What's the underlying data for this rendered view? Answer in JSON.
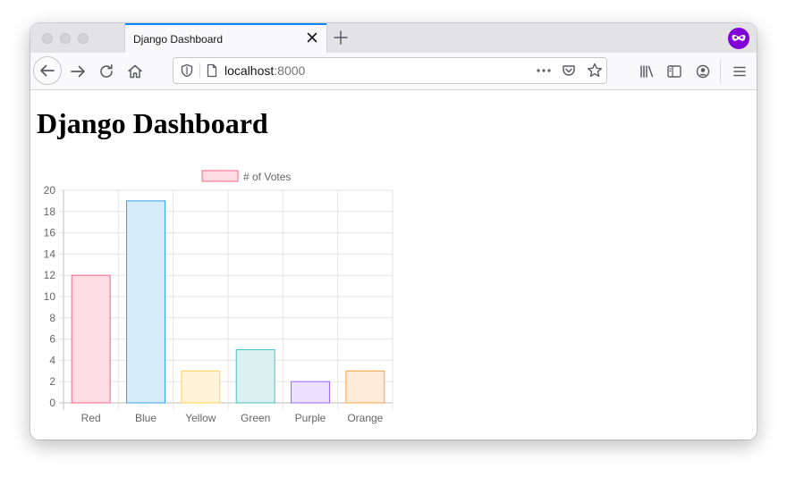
{
  "browser": {
    "tab": {
      "title": "Django Dashboard"
    },
    "url": {
      "host": "localhost",
      "port": ":8000"
    },
    "icons": {
      "back": "back-arrow-icon",
      "forward": "forward-arrow-icon",
      "reload": "reload-icon",
      "home": "home-icon",
      "shield": "shield-icon",
      "page": "page-icon",
      "more": "more-dots-icon",
      "pocket": "pocket-icon",
      "bookmark": "star-icon",
      "library": "library-icon",
      "sidebar": "sidebar-icon",
      "account": "account-icon",
      "menu": "hamburger-menu-icon",
      "private": "private-browsing-icon"
    },
    "accent_color": "#0a84ff",
    "private_color": "#8000d7"
  },
  "page": {
    "title": "Django Dashboard"
  },
  "chart_data": {
    "type": "bar",
    "categories": [
      "Red",
      "Blue",
      "Yellow",
      "Green",
      "Purple",
      "Orange"
    ],
    "series": [
      {
        "name": "# of Votes",
        "values": [
          12,
          19,
          3,
          5,
          2,
          3
        ]
      }
    ],
    "ylim": [
      0,
      20
    ],
    "yticks": [
      "0",
      "2",
      "4",
      "6",
      "8",
      "10",
      "12",
      "14",
      "16",
      "18",
      "20"
    ],
    "grid": true,
    "legend": "top",
    "colors": {
      "fill": [
        "#ffdde4",
        "#d6ebfa",
        "#fff4da",
        "#dbf1f1",
        "#ebe0ff",
        "#ffecd8"
      ],
      "stroke": [
        "#ff6384",
        "#36a2eb",
        "#ffce56",
        "#4bc0c0",
        "#9966ff",
        "#ff9f40"
      ]
    }
  }
}
